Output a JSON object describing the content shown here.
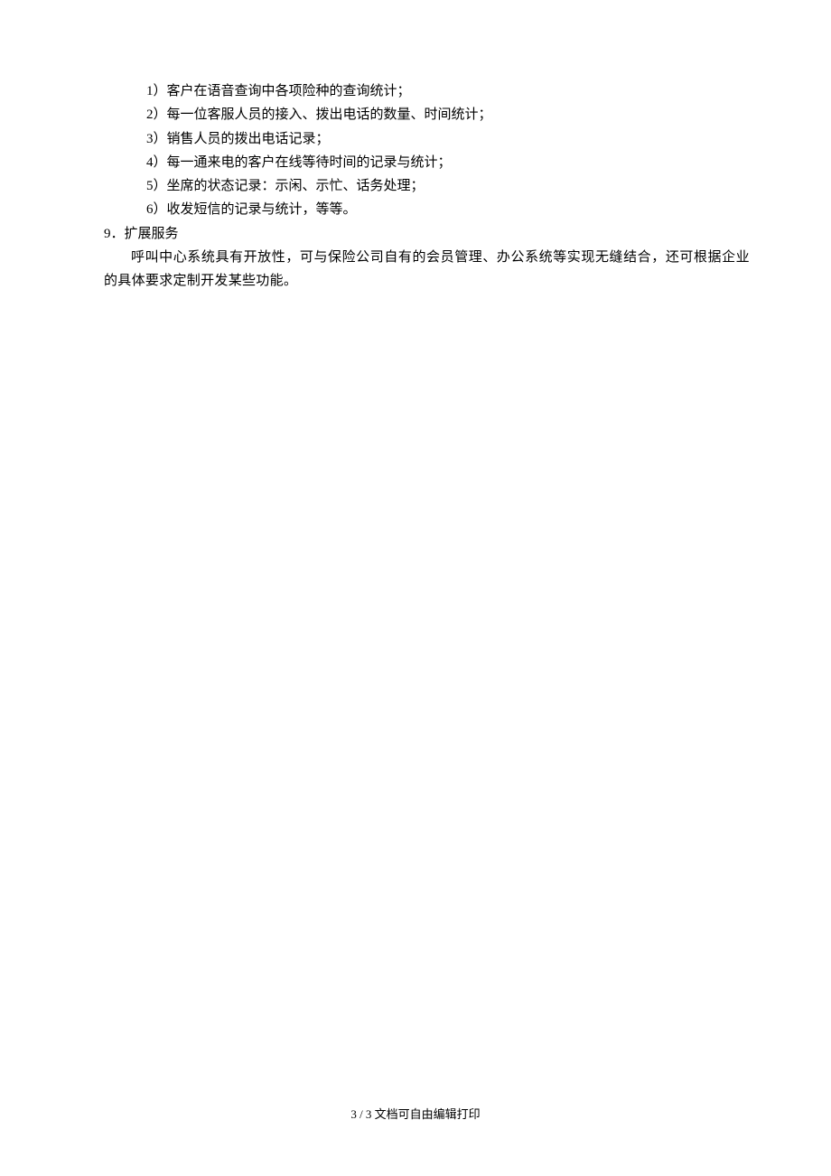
{
  "items": {
    "item1": "1）客户在语音查询中各项险种的查询统计；",
    "item2": "2）每一位客服人员的接入、拨出电话的数量、时间统计；",
    "item3": "3）销售人员的拨出电话记录；",
    "item4": "4）每一通来电的客户在线等待时间的记录与统计；",
    "item5": "5）坐席的状态记录：示闲、示忙、话务处理；",
    "item6": "6）收发短信的记录与统计，等等。"
  },
  "section9": {
    "heading": "9．扩展服务",
    "body": "呼叫中心系统具有开放性，可与保险公司自有的会员管理、办公系统等实现无缝结合，还可根据企业的具体要求定制开发某些功能。"
  },
  "footer": {
    "text": "3 / 3 文档可自由编辑打印"
  }
}
